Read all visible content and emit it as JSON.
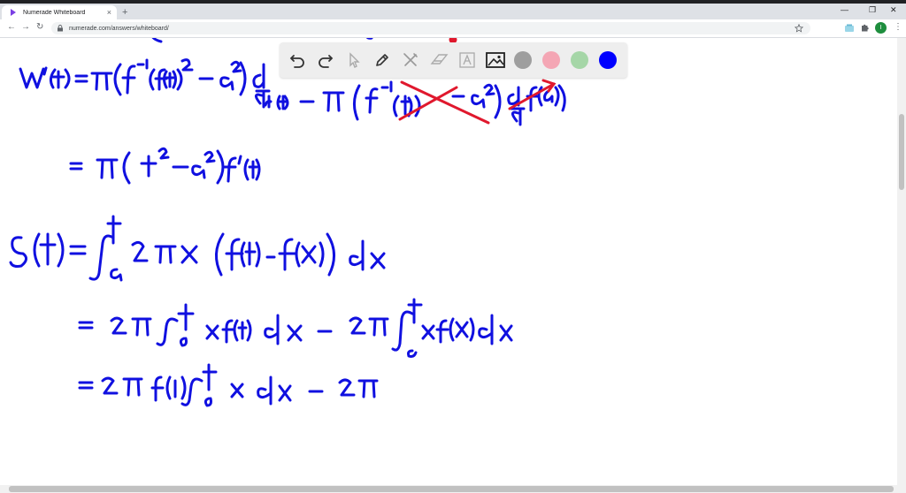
{
  "browser": {
    "tab_title": "Numerade Whiteboard",
    "tab_close": "×",
    "new_tab": "+",
    "minimize": "—",
    "maximize": "❐",
    "close": "✕",
    "back": "←",
    "forward": "→",
    "reload": "↻",
    "url": "numerade.com/answers/whiteboard/",
    "profile_initial": "I"
  },
  "toolbar": {
    "colors": [
      "#9e9e9e",
      "#f4a6b4",
      "#a5d6a7",
      "#0000ff"
    ]
  },
  "ink": {
    "blue": "#1010e0",
    "red": "#e0182d"
  },
  "icons": [
    "undo-icon",
    "redo-icon",
    "pointer-icon",
    "pen-icon",
    "tools-icon",
    "eraser-icon",
    "text-icon",
    "image-icon"
  ]
}
